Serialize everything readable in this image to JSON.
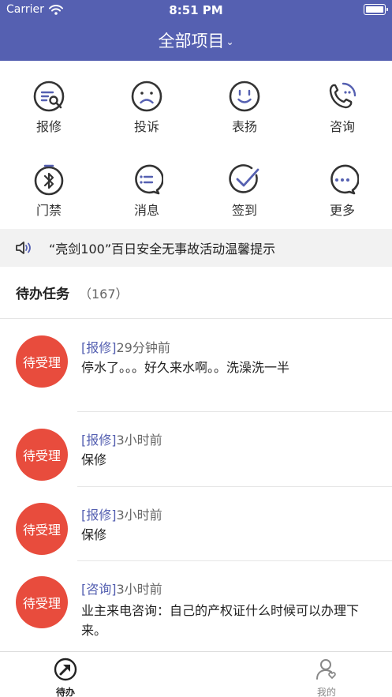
{
  "status": {
    "carrier": "Carrier",
    "time": "8:51 PM"
  },
  "header": {
    "title": "全部项目",
    "chevron": "chevron-down-icon"
  },
  "grid": [
    {
      "label": "报修",
      "icon": "repair-icon"
    },
    {
      "label": "投诉",
      "icon": "complaint-icon"
    },
    {
      "label": "表扬",
      "icon": "praise-icon"
    },
    {
      "label": "咨询",
      "icon": "consult-icon"
    },
    {
      "label": "门禁",
      "icon": "access-icon"
    },
    {
      "label": "消息",
      "icon": "message-icon"
    },
    {
      "label": "签到",
      "icon": "checkin-icon"
    },
    {
      "label": "更多",
      "icon": "more-icon"
    }
  ],
  "notice": {
    "text": "“亮剑100”百日安全无事故活动温馨提示",
    "icon": "speaker-icon"
  },
  "tasks": {
    "title": "待办任务",
    "count": "（167）",
    "items": [
      {
        "status": "待受理",
        "category": "[报修]",
        "time": "29分钟前",
        "content": "停水了。。。好久来水啊。。洗澡洗一半"
      },
      {
        "status": "待受理",
        "category": "[报修]",
        "time": "3小时前",
        "content": "保修"
      },
      {
        "status": "待受理",
        "category": "[报修]",
        "time": "3小时前",
        "content": "保修"
      },
      {
        "status": "待受理",
        "category": "[咨询]",
        "time": "3小时前",
        "content": "业主来电咨询：自己的产权证什么时候可以办理下来。"
      }
    ]
  },
  "tabbar": [
    {
      "label": "待办",
      "icon": "todo-icon",
      "active": true
    },
    {
      "label": "我的",
      "icon": "profile-icon",
      "active": false
    }
  ],
  "colors": {
    "primary": "#5560b1",
    "badge": "#e84c3d",
    "icon_dark": "#333333",
    "icon_accent": "#5560b1"
  }
}
